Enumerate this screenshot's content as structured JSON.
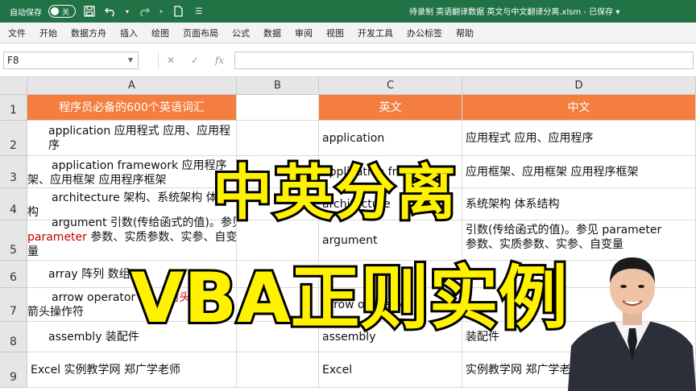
{
  "titlebar": {
    "autosave_label": "自动保存",
    "autosave_state": "关",
    "title": "待录制 英语翻译数据 英文与中文翻译分离.xlsm - 已保存 ▾"
  },
  "menu": [
    "文件",
    "开始",
    "数据方舟",
    "插入",
    "绘图",
    "页面布局",
    "公式",
    "数据",
    "审阅",
    "视图",
    "开发工具",
    "办公标签",
    "帮助"
  ],
  "formula_bar": {
    "name_box": "F8",
    "cancel_icon": "✕",
    "enter_icon": "✓",
    "fx_label": "fx",
    "content": ""
  },
  "columns": [
    "A",
    "B",
    "C",
    "D"
  ],
  "rows": [
    "1",
    "2",
    "3",
    "4",
    "5",
    "6",
    "7",
    "8",
    "9"
  ],
  "cells": {
    "A1": "程序员必备的600个英语词汇",
    "C1": "英文",
    "D1": "中文",
    "A2": "application 应用程式 应用、应用程序",
    "A3_line1": "application framework 应用程序",
    "A3_line2": "架、应用框架 应用程序框架",
    "A4_line1": "architecture 架构、系统架构 体系",
    "A4_line2": "构",
    "A5_line1": "argument 引数(传给函式的值)。参见",
    "A5_red": "parameter",
    "A5_line2": " 参数、实质参数、实参、自变",
    "A5_line3": "量",
    "A6": "array 阵列 数组",
    "A7_line1": "arrow operator",
    "A7_line1_tail": "箭头",
    "A7_line2": "箭头操作符",
    "A8": "assembly 装配件",
    "A9": "Excel 实例教学网 郑广学老师",
    "C2": "application",
    "C3": "application framework",
    "C4": "architecture",
    "C5": "argument",
    "C7": "arrow operator",
    "C8": "assembly",
    "C9": "Excel",
    "D2": "应用程式 应用、应用程序",
    "D3": "应用框架、应用框架 应用程序框架",
    "D4": "系统架构 体系结构",
    "D5_line1": "引数(传给函式的值)。参见 parameter",
    "D5_line2": "参数、实质参数、实参、自变量",
    "D8": "装配件",
    "D9": "实例教学网 郑广学老"
  },
  "overlay": {
    "line1": "中英分离",
    "line2": "VBA正则实例"
  },
  "colors": {
    "excel_green": "#217346",
    "header_orange": "#f37e3f",
    "overlay_yellow": "#fff200"
  },
  "icons": [
    "save-icon",
    "undo-icon",
    "redo-icon",
    "file-icon",
    "customize-icon"
  ]
}
